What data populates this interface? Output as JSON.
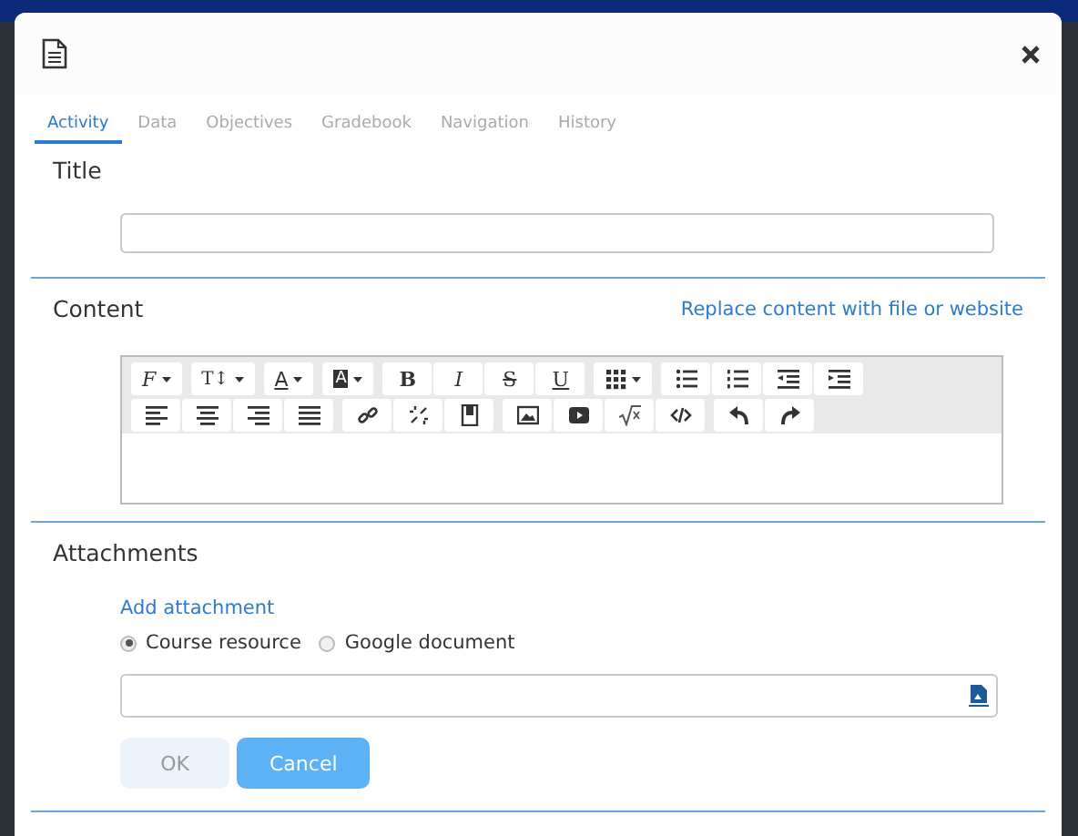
{
  "tabs": [
    {
      "label": "Activity",
      "selected": true
    },
    {
      "label": "Data",
      "selected": false
    },
    {
      "label": "Objectives",
      "selected": false
    },
    {
      "label": "Gradebook",
      "selected": false
    },
    {
      "label": "Navigation",
      "selected": false
    },
    {
      "label": "History",
      "selected": false
    }
  ],
  "title_section": {
    "heading": "Title"
  },
  "content_section": {
    "heading": "Content",
    "link": "Replace content with file or website",
    "toolbar": [
      [
        [
          {
            "kind": "font",
            "label": "F",
            "dropdown": true
          }
        ],
        [
          {
            "kind": "size",
            "label": "T↕",
            "dropdown": true
          }
        ],
        [
          {
            "kind": "color",
            "label": "A",
            "dropdown": true
          }
        ],
        [
          {
            "kind": "highlight",
            "label": "A",
            "dropdown": true
          }
        ],
        [
          {
            "kind": "bold",
            "label": "B"
          },
          {
            "kind": "italic",
            "label": "I"
          },
          {
            "kind": "strike",
            "label": "S"
          },
          {
            "kind": "underline",
            "label": "U"
          }
        ],
        [
          {
            "kind": "table",
            "dropdown": true
          }
        ],
        [
          {
            "kind": "bullets"
          },
          {
            "kind": "numbers"
          },
          {
            "kind": "outdent"
          },
          {
            "kind": "indent"
          }
        ]
      ],
      [
        [
          {
            "kind": "alignleft"
          },
          {
            "kind": "center"
          },
          {
            "kind": "alignright"
          },
          {
            "kind": "justify"
          }
        ],
        [
          {
            "kind": "link"
          },
          {
            "kind": "unlink"
          },
          {
            "kind": "bookmark"
          }
        ],
        [
          {
            "kind": "image"
          },
          {
            "kind": "video"
          },
          {
            "kind": "formula"
          },
          {
            "kind": "code"
          }
        ],
        [
          {
            "kind": "undo"
          },
          {
            "kind": "redo"
          }
        ]
      ]
    ]
  },
  "attachments_section": {
    "heading": "Attachments",
    "link": "Add attachment",
    "options": [
      {
        "label": "Course resource",
        "selected": true
      },
      {
        "label": "Google document",
        "selected": false
      }
    ]
  },
  "buttons": [
    {
      "label": "OK",
      "kind": "primary",
      "disabled": true
    },
    {
      "label": "Cancel",
      "kind": "secondary",
      "disabled": false
    }
  ]
}
